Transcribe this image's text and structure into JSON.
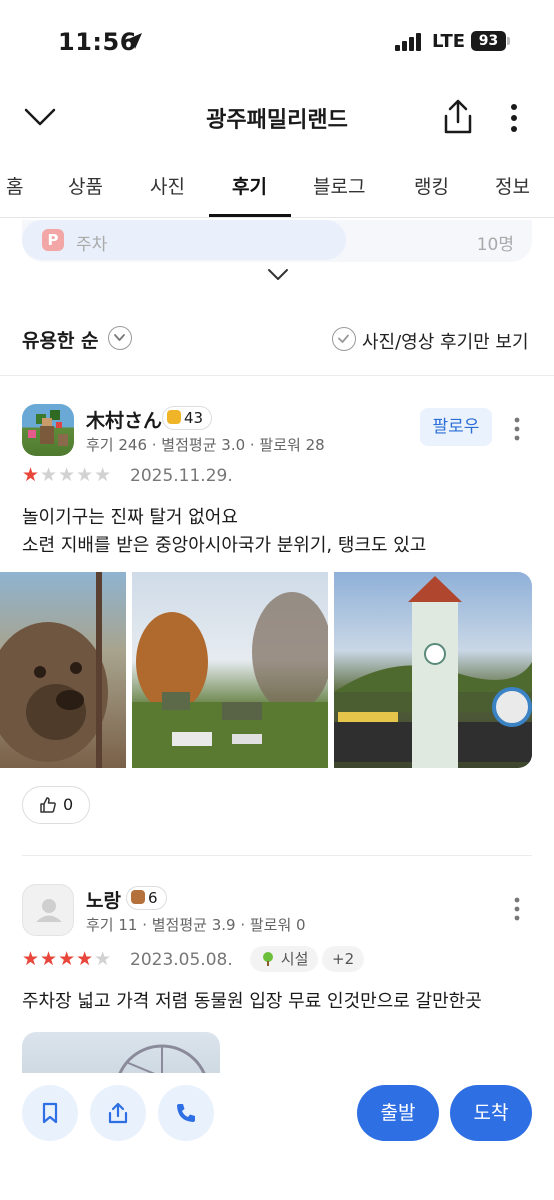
{
  "status_bar": {
    "time": "11:56",
    "network": "LTE",
    "battery": "93"
  },
  "header": {
    "title": "광주패밀리랜드"
  },
  "tabs": [
    {
      "label": "홈"
    },
    {
      "label": "상품"
    },
    {
      "label": "사진"
    },
    {
      "label": "후기"
    },
    {
      "label": "블로그"
    },
    {
      "label": "랭킹"
    },
    {
      "label": "정보"
    }
  ],
  "active_tab": "후기",
  "parking": {
    "icon_letter": "P",
    "label": "주차",
    "count": "10명"
  },
  "sort": {
    "label": "유용한 순",
    "photo_filter_label": "사진/영상 후기만 보기"
  },
  "reviews": [
    {
      "user": "木村さん",
      "level": "43",
      "meta": "후기 246 · 별점평균 3.0 · 팔로워 28",
      "follow_label": "팔로우",
      "rating": 1,
      "date": "2025.11.29.",
      "text_line1": "놀이기구는 진짜 탈거 없어요",
      "text_line2": "소련 지배를 받은 중앙아시아국가 분위기, 탱크도 있고",
      "likes": "0"
    },
    {
      "user": "노랑",
      "level": "6",
      "meta": "후기 11 · 별점평균 3.9 · 팔로워 0",
      "rating": 4,
      "date": "2023.05.08.",
      "tag": "시설",
      "tag_more": "+2",
      "text_line1": "주차장 넓고 가격 저렴 동물원 입장 무료 인것만으로 갈만한곳"
    }
  ],
  "bottom": {
    "depart_label": "출발",
    "arrive_label": "도착"
  },
  "colors": {
    "accent": "#2f6fe4",
    "star": "#e8463a",
    "follow_bg": "#eaf2fd"
  }
}
